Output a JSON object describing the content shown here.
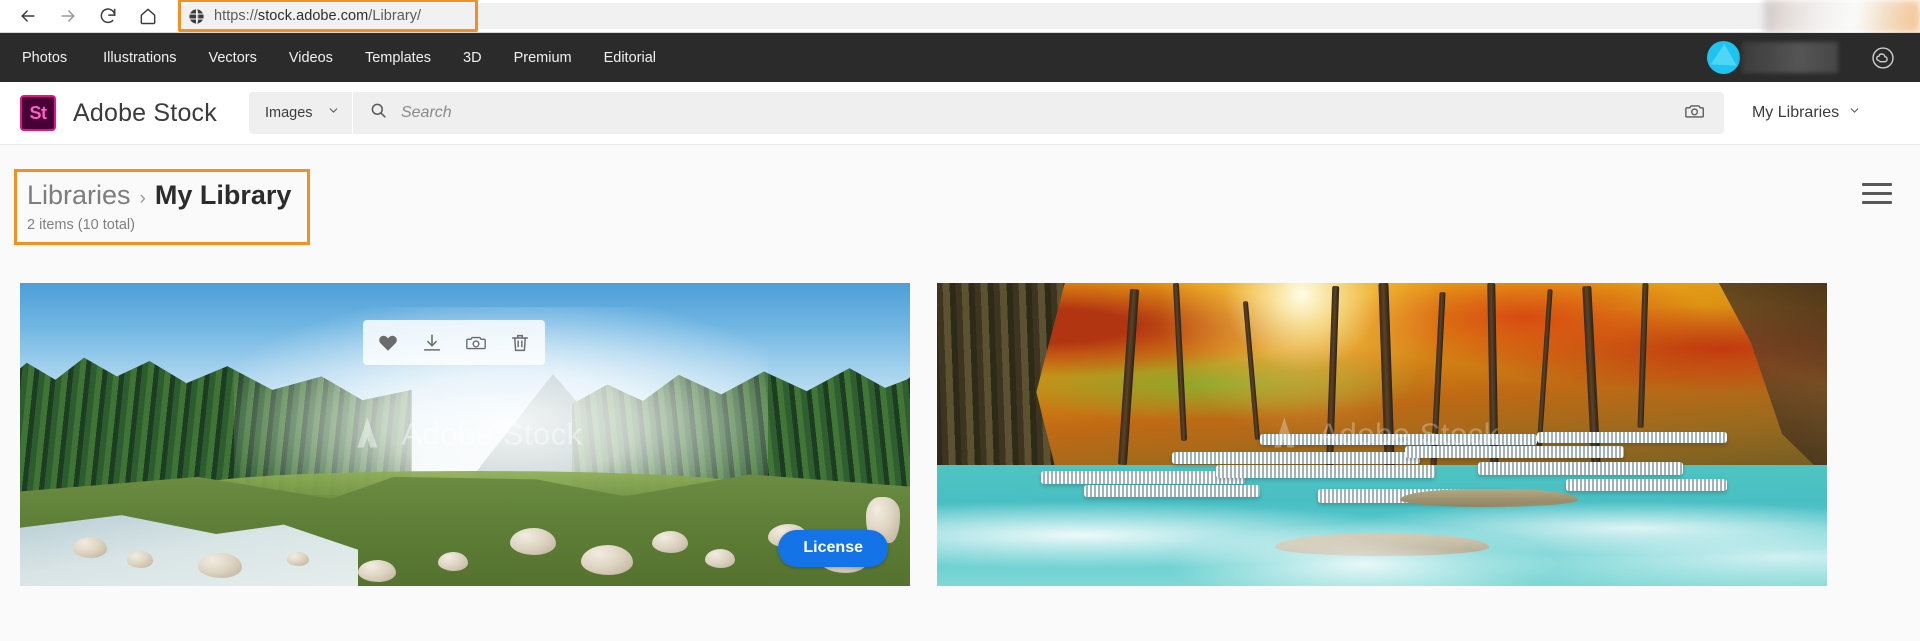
{
  "browser": {
    "back_icon": "back-arrow-icon",
    "forward_icon": "forward-arrow-icon",
    "reload_icon": "reload-icon",
    "home_icon": "home-icon",
    "site_icon": "globe-icon",
    "url_scheme": "https://",
    "url_host": "stock.adobe.com",
    "url_path": "/Library/",
    "url_full": "https://stock.adobe.com/Library/",
    "highlight_color": "#f29122"
  },
  "top_nav": {
    "items": [
      {
        "label": "Photos"
      },
      {
        "label": "Illustrations"
      },
      {
        "label": "Vectors"
      },
      {
        "label": "Videos"
      },
      {
        "label": "Templates"
      },
      {
        "label": "3D"
      },
      {
        "label": "Premium"
      },
      {
        "label": "Editorial"
      }
    ],
    "avatar": "user-avatar",
    "avatar_color": "#1ec3f0",
    "cc_icon": "creative-cloud-icon",
    "background": "#2b2b2b"
  },
  "header": {
    "logo_mark": "St",
    "logo_bg": "#470137",
    "logo_border": "#e8118b",
    "brand": "Adobe Stock",
    "search": {
      "type_label": "Images",
      "type_chevron": "chevron-down-icon",
      "search_icon": "search-icon",
      "placeholder": "Search",
      "value": "",
      "camera_icon": "camera-search-icon"
    },
    "my_libraries_label": "My Libraries",
    "my_libraries_chevron": "chevron-down-icon"
  },
  "page": {
    "breadcrumb_root": "Libraries",
    "breadcrumb_sep": "›",
    "breadcrumb_current": "My Library",
    "count_text": "2 items (10 total)",
    "highlight_color": "#f29122",
    "menu_icon": "hamburger-menu-icon"
  },
  "grid": {
    "items": [
      {
        "alt": "Mountain river with pine forest and misty peak",
        "watermark": "Adobe Stock",
        "watermark_logo": "adobe-a-icon",
        "hovered": true,
        "tools": [
          {
            "name": "favorite-icon",
            "label": "Favorite"
          },
          {
            "name": "download-icon",
            "label": "Download"
          },
          {
            "name": "find-similar-icon",
            "label": "Find similar"
          },
          {
            "name": "delete-icon",
            "label": "Delete"
          }
        ],
        "license_label": "License",
        "license_color": "#1473e6"
      },
      {
        "alt": "Autumn forest waterfall with turquoise water",
        "watermark": "Adobe Stock",
        "watermark_logo": "adobe-a-icon",
        "hovered": false
      }
    ]
  }
}
